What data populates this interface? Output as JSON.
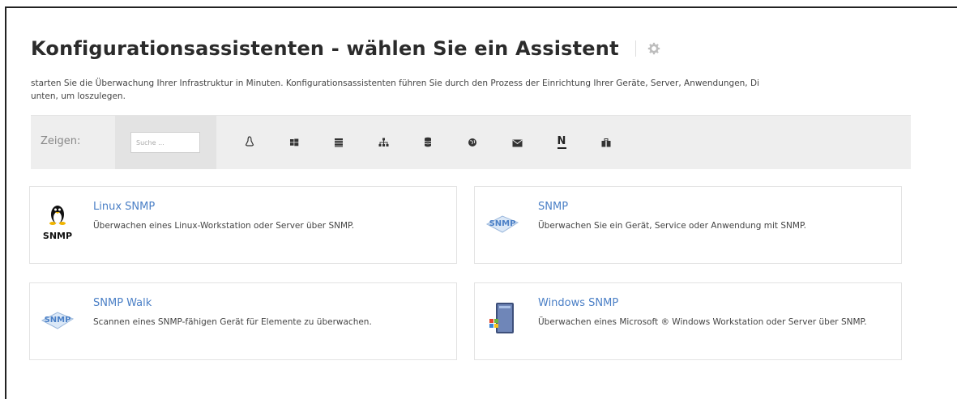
{
  "page": {
    "title": "Konfigurationsassistenten - wählen Sie ein Assistent",
    "intro_line1": "starten Sie die Überwachung Ihrer Infrastruktur in Minuten. Konfigurationsassistenten führen Sie durch den Prozess der Einrichtung Ihrer Geräte, Server, Anwendungen, Di",
    "intro_line2": "unten, um loszulegen."
  },
  "filter": {
    "label": "Zeigen:",
    "search_placeholder": "Suche ...",
    "category_icons": [
      "linux-icon",
      "windows-icon",
      "server-list-icon",
      "network-icon",
      "database-icon",
      "globe-icon",
      "email-icon",
      "nagios-icon",
      "toolbox-icon"
    ],
    "nagios_letter": "N"
  },
  "wizards": [
    {
      "name": "Linux SNMP",
      "description": "Überwachen eines Linux-Workstation oder Server über SNMP.",
      "icon": "linux-snmp-icon",
      "icon_text": "SNMP"
    },
    {
      "name": "SNMP",
      "description": "Überwachen Sie ein Gerät, Service oder Anwendung mit SNMP.",
      "icon": "snmp-icon",
      "icon_text": "SNMP"
    },
    {
      "name": "SNMP Walk",
      "description": "Scannen eines SNMP-fähigen Gerät für Elemente zu überwachen.",
      "icon": "snmp-walk-icon",
      "icon_text": "SNMP"
    },
    {
      "name": "Windows SNMP",
      "description": "Überwachen eines Microsoft ® Windows Workstation oder Server über SNMP.",
      "icon": "windows-snmp-icon"
    }
  ],
  "colors": {
    "link": "#4a7fc6",
    "filterbar_bg": "#eeeeee",
    "card_border": "#e3e3e3"
  }
}
